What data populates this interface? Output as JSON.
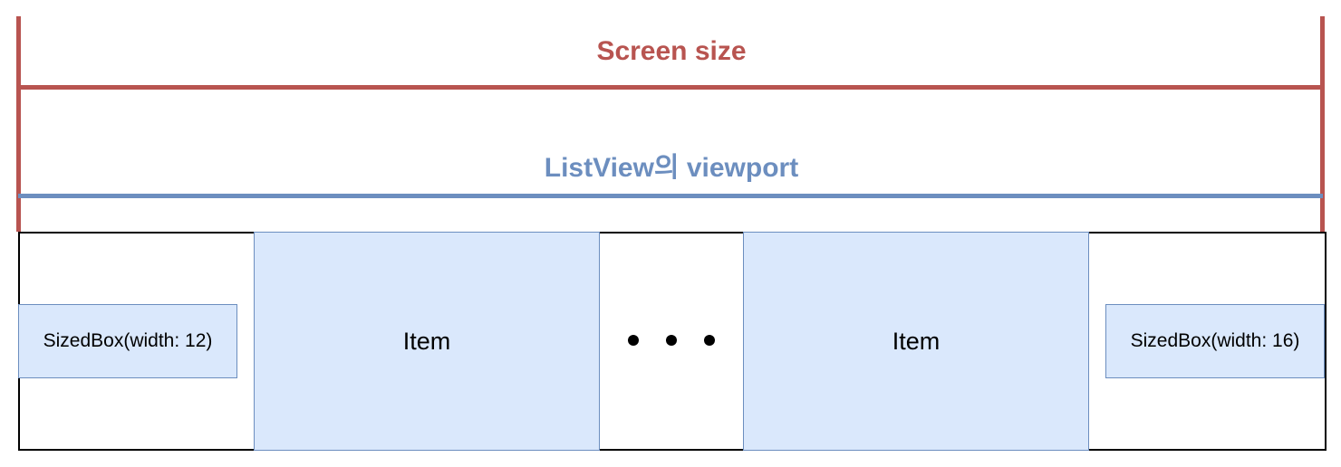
{
  "diagram": {
    "screen": {
      "label": "Screen size",
      "color": "#b85450"
    },
    "viewport": {
      "label": "ListView의 viewport",
      "color": "#6c8ebf"
    },
    "list": {
      "leading_spacer": "SizedBox(width: 12)",
      "items": [
        "Item",
        "Item"
      ],
      "trailing_spacer": "SizedBox(width: 16)",
      "item_fill": "#dae8fc",
      "item_stroke": "#6c8ebf"
    }
  }
}
